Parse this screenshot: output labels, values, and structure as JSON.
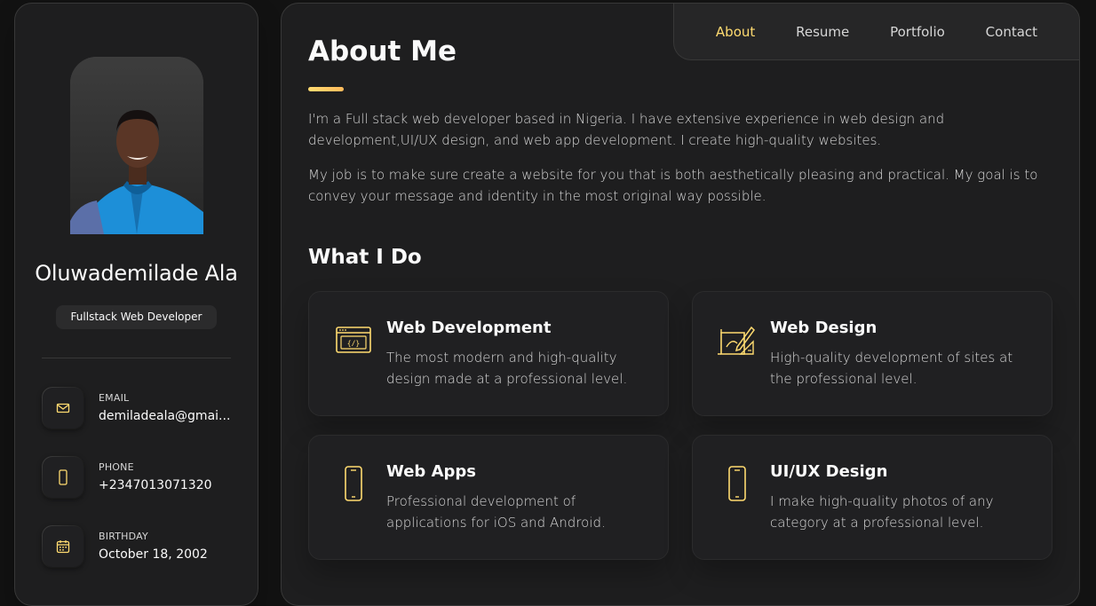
{
  "sidebar": {
    "name": "Oluwademilade Ala",
    "title": "Fullstack Web Developer",
    "contacts": [
      {
        "label": "Email",
        "value": "demiladeala@gmai..."
      },
      {
        "label": "Phone",
        "value": "+2347013071320"
      },
      {
        "label": "Birthday",
        "value": "October 18, 2002"
      }
    ]
  },
  "nav": {
    "items": [
      {
        "label": "About"
      },
      {
        "label": "Resume"
      },
      {
        "label": "Portfolio"
      },
      {
        "label": "Contact"
      }
    ],
    "active": "About"
  },
  "about": {
    "title": "About Me",
    "paragraphs": [
      "I'm a Full stack web developer based in Nigeria. I have extensive experience in web design and development,UI/UX design, and web app development. I create high-quality websites.",
      "My job is to make sure create a website for you that is both aesthetically pleasing and practical. My goal is to convey your message and identity in the most original way possible."
    ]
  },
  "services": {
    "title": "What I Do",
    "items": [
      {
        "icon": "code-window-icon",
        "title": "Web Development",
        "desc": "The most modern and high-quality design made at a professional level."
      },
      {
        "icon": "design-tools-icon",
        "title": "Web Design",
        "desc": "High-quality development of sites at the professional level."
      },
      {
        "icon": "smartphone-icon",
        "title": "Web Apps",
        "desc": "Professional development of applications for iOS and Android."
      },
      {
        "icon": "smartphone-icon",
        "title": "UI/UX Design",
        "desc": "I make high-quality photos of any category at a professional level."
      }
    ]
  },
  "colors": {
    "accent": "#ffdb70",
    "background": "#121212",
    "card": "#1e1e1f",
    "text": "#d6d6d6"
  }
}
